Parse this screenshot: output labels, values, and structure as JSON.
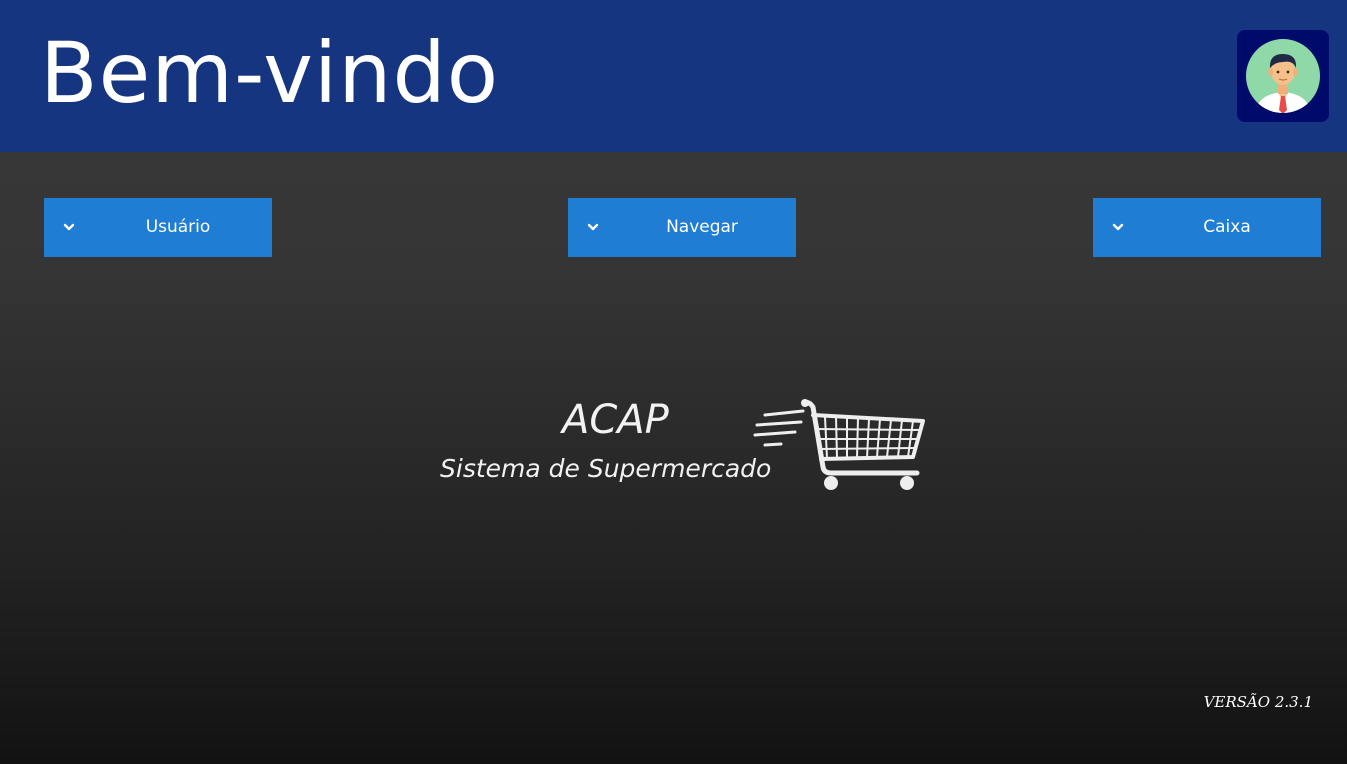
{
  "header": {
    "title": "Bem-vindo",
    "avatar_icon": "user-avatar-icon",
    "background_color": "#163580"
  },
  "menu": {
    "buttons": [
      {
        "label": "Usuário",
        "icon": "chevron-down-icon"
      },
      {
        "label": "Navegar",
        "icon": "chevron-down-icon"
      },
      {
        "label": "Caixa",
        "icon": "chevron-down-icon"
      }
    ],
    "button_color": "#1f7dd3"
  },
  "logo": {
    "name": "ACAP",
    "subtitle": "Sistema de Supermercado",
    "icon": "shopping-cart-icon"
  },
  "footer": {
    "version": "VERSÃO 2.3.1"
  }
}
